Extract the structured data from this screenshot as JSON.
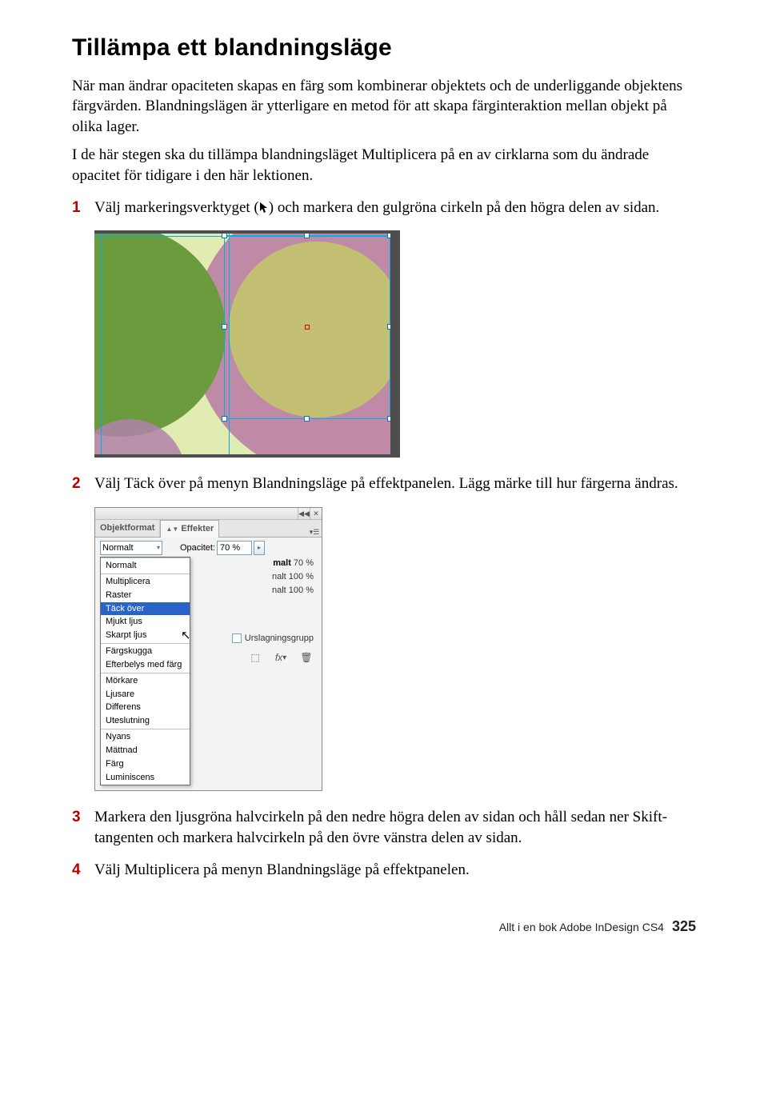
{
  "title": "Tillämpa ett blandningsläge",
  "intro": [
    "När man ändrar opaciteten skapas en färg som kombinerar objektets och de underliggande objektens färgvärden. Blandningslägen är ytterligare en metod för att skapa färginteraktion mellan objekt på olika lager.",
    "I de här stegen ska du tillämpa blandningsläget Multiplicera på en av cirklarna som du ändrade opacitet för tidigare i den här lektionen."
  ],
  "steps": {
    "s1a": "Välj markeringsverktyget (",
    "s1b": ") och markera den gulgröna cirkeln på den högra delen av sidan.",
    "s2": "Välj Täck över på menyn Blandningsläge på effektpanelen. Lägg märke till hur färgerna ändras.",
    "s3": "Markera den ljusgröna halvcirkeln på den nedre högra delen av sidan och håll sedan ner Skift-tangenten och markera halvcirkeln på den övre vänstra delen av sidan.",
    "s4": "Välj Multiplicera på menyn Blandningsläge på effektpanelen."
  },
  "panel": {
    "tab_objektformat": "Objektformat",
    "tab_effekter": "Effekter",
    "mode_value": "Normalt",
    "opacity_label": "Opacitet:",
    "opacity_value": "70 %",
    "right_lines": {
      "l1_label": "malt",
      "l1_val": "70 %",
      "l2_label": "nalt",
      "l2_val": "100 %",
      "l3_label": "nalt",
      "l3_val": "100 %"
    },
    "urslagning": "Urslagningsgrupp",
    "fx_label": "fx",
    "blend_modes": {
      "g1": [
        "Normalt"
      ],
      "g2": [
        "Multiplicera",
        "Raster",
        "Täck över",
        "Mjukt ljus",
        "Skarpt ljus"
      ],
      "g3": [
        "Färgskugga",
        "Efterbelys med färg"
      ],
      "g4": [
        "Mörkare",
        "Ljusare",
        "Differens",
        "Uteslutning"
      ],
      "g5": [
        "Nyans",
        "Mättnad",
        "Färg",
        "Luminiscens"
      ]
    },
    "selected_mode": "Täck över"
  },
  "footer": {
    "book": "Allt i en bok Adobe InDesign CS4",
    "page": "325"
  }
}
